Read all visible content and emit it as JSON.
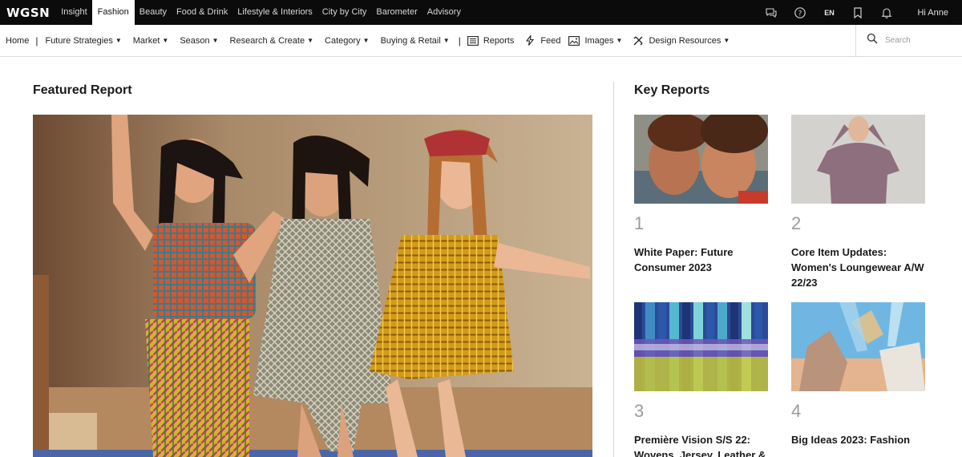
{
  "brand": {
    "logo": "WGSN"
  },
  "top_tabs": [
    {
      "label": "Insight",
      "active": false
    },
    {
      "label": "Fashion",
      "active": true
    },
    {
      "label": "Beauty",
      "active": false
    },
    {
      "label": "Food & Drink",
      "active": false
    },
    {
      "label": "Lifestyle & Interiors",
      "active": false
    },
    {
      "label": "City by City",
      "active": false
    },
    {
      "label": "Barometer",
      "active": false
    },
    {
      "label": "Advisory",
      "active": false
    }
  ],
  "top_right": {
    "language": "EN",
    "greeting": "Hi Anne"
  },
  "nav": {
    "home": "Home",
    "future_strategies": "Future Strategies",
    "market": "Market",
    "season": "Season",
    "research_create": "Research & Create",
    "category": "Category",
    "buying_retail": "Buying & Retail",
    "reports": "Reports",
    "feed": "Feed",
    "images": "Images",
    "design_resources": "Design Resources"
  },
  "search": {
    "placeholder": "Search"
  },
  "featured": {
    "heading": "Featured Report"
  },
  "key_reports": {
    "heading": "Key Reports",
    "items": [
      {
        "number": "1",
        "title": "White Paper: Future Consumer 2023"
      },
      {
        "number": "2",
        "title": "Core Item Updates: Women's Loungewear A/W 22/23"
      },
      {
        "number": "3",
        "title": "Première Vision S/S 22: Wovens, Jersey, Leather &"
      },
      {
        "number": "4",
        "title": "Big Ideas 2023: Fashion"
      }
    ]
  },
  "colors": {
    "topbar": "#0b0b0b",
    "accent_strip": "#4a66a8",
    "number_grey": "#9b9b9b"
  }
}
